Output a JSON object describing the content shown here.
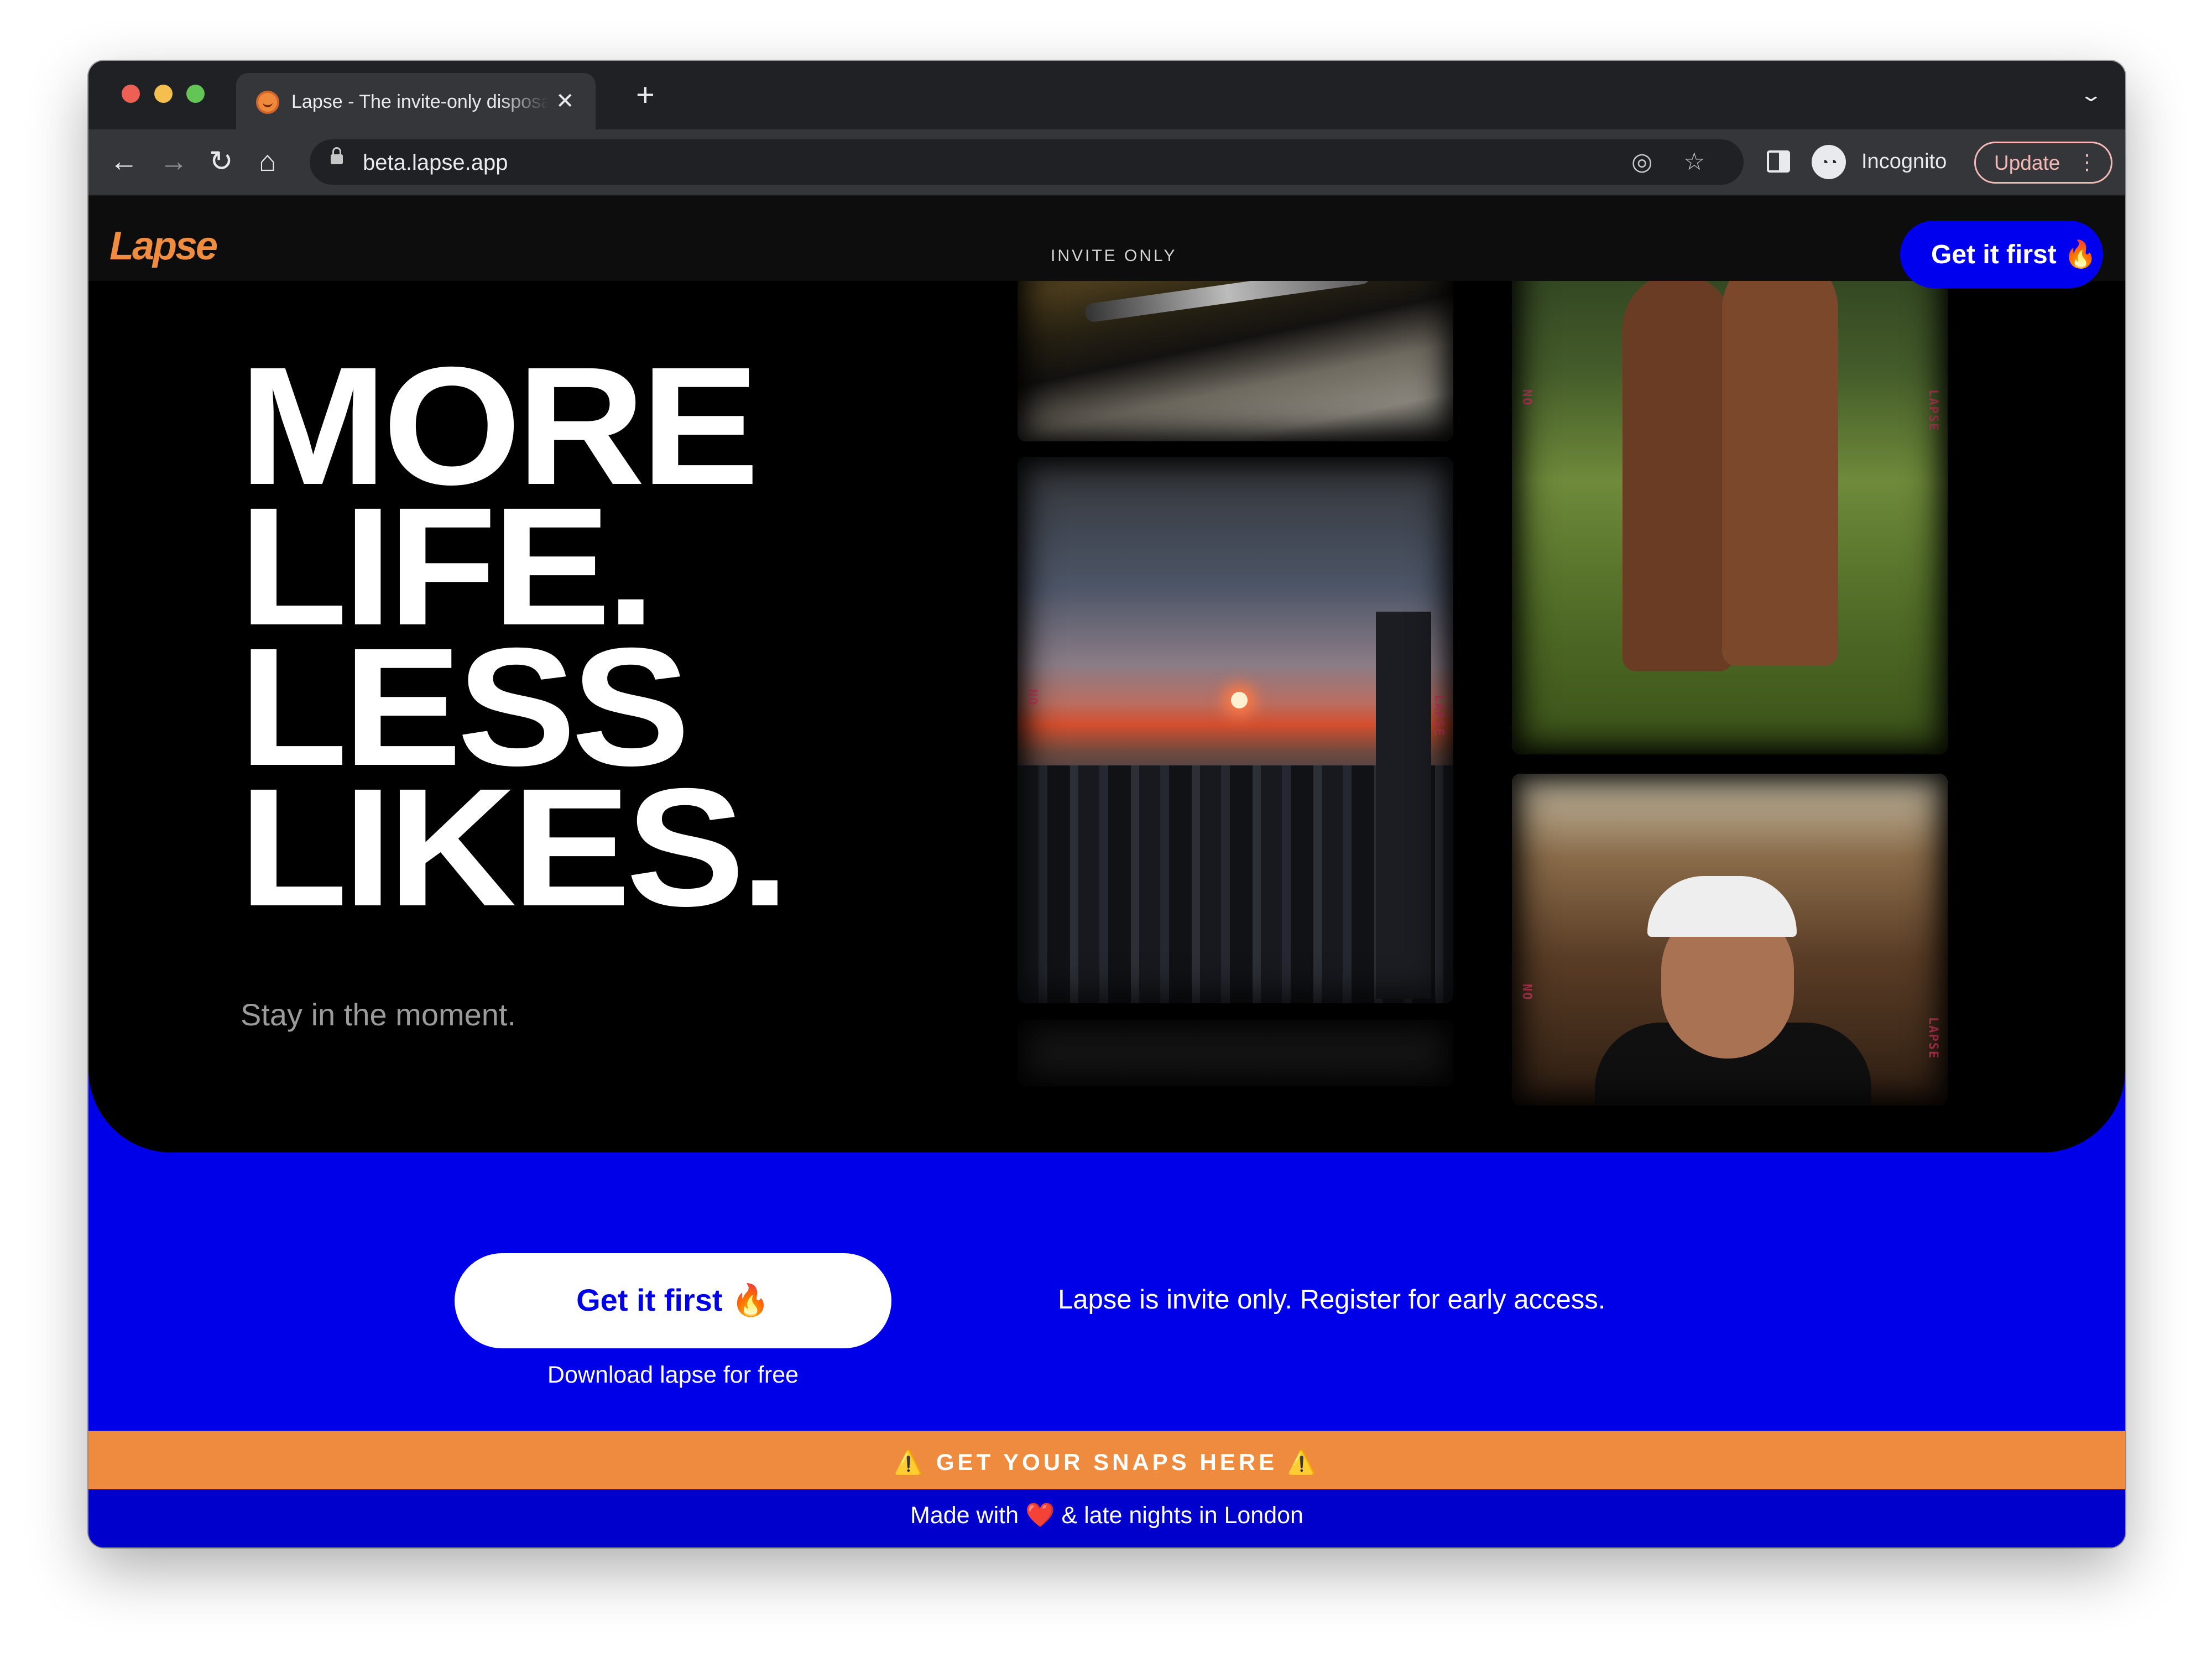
{
  "browser": {
    "tab_title": "Lapse - The invite-only disposable camera",
    "tab_close": "✕",
    "new_tab": "+",
    "tab_list": "⌄",
    "url": "beta.lapse.app",
    "back": "←",
    "forward": "→",
    "reload": "↻",
    "home": "⌂",
    "eye_off": "◎",
    "star": "☆",
    "incognito_glyph": "◔◔",
    "incognito_label": "Incognito",
    "update_label": "Update",
    "kebab": "⋮"
  },
  "header": {
    "logo": "Lapse",
    "center_label": "INVITE ONLY",
    "cta_label": "Get it first 🔥"
  },
  "hero": {
    "headline": [
      "MORE",
      "LIFE.",
      "LESS",
      "LIKES."
    ],
    "tagline": "Stay in the moment.",
    "film_tags": [
      "NO",
      "LAPSE",
      "NO",
      "LAPSE",
      "NO",
      "LAPSE"
    ]
  },
  "cta": {
    "button_label": "Get it first 🔥",
    "subtext": "Download lapse for free",
    "info": "Lapse is invite only. Register for early access."
  },
  "banner": {
    "text": "⚠️ GET YOUR SNAPS HERE ⚠️"
  },
  "footer": {
    "text": "Made with ❤️ & late nights in London"
  },
  "colors": {
    "brand_orange": "#ef8c3f",
    "brand_blue": "#0000e8",
    "footer_blue": "#0000cc",
    "hero_black": "#000000"
  },
  "icons": [
    "back-arrow-icon",
    "forward-arrow-icon",
    "reload-icon",
    "home-icon",
    "lock-icon",
    "eye-off-icon",
    "star-icon",
    "side-panel-icon",
    "incognito-icon",
    "kebab-menu-icon",
    "close-icon",
    "plus-icon",
    "chevron-down-icon",
    "favicon-icon"
  ]
}
